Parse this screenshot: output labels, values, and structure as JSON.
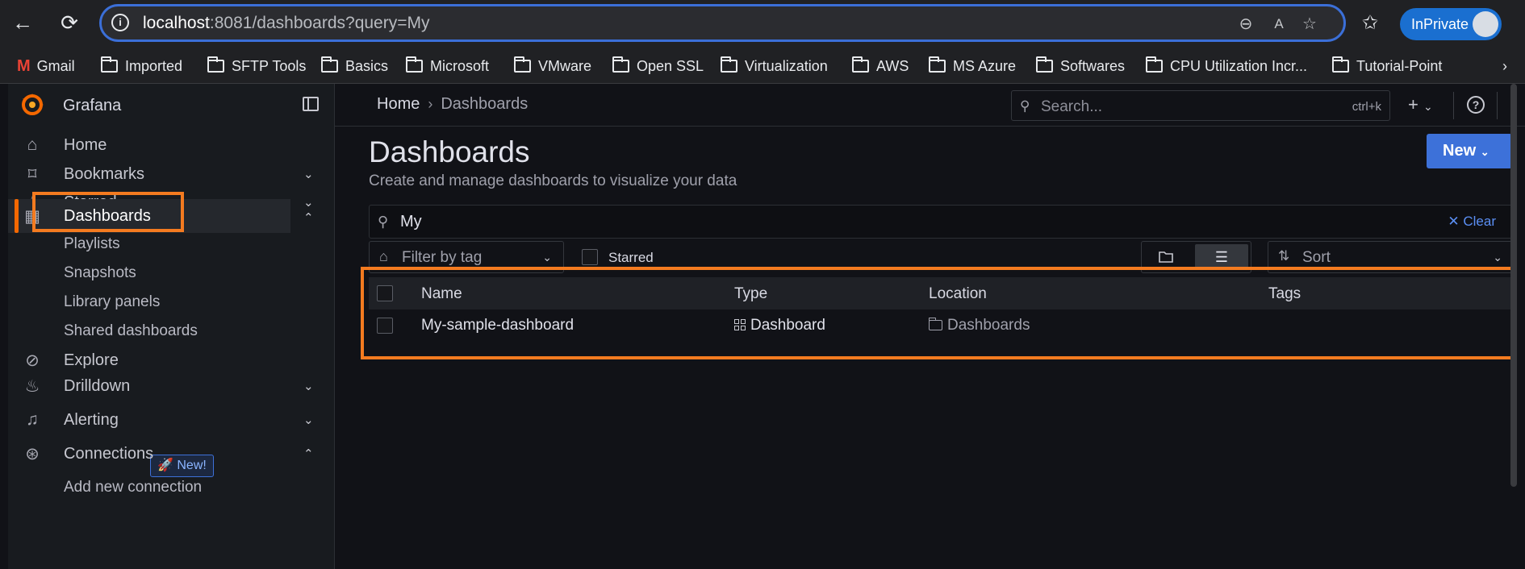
{
  "browser": {
    "url_host": "localhost",
    "url_rest": ":8081/dashboards?query=My",
    "inprivate_label": "InPrivate",
    "bookmarks": [
      "Gmail",
      "Imported",
      "SFTP Tools",
      "Basics",
      "Microsoft",
      "VMware",
      "Open SSL",
      "Virtualization",
      "AWS",
      "MS Azure",
      "Softwares",
      "CPU Utilization Incr...",
      "Tutorial-Point"
    ]
  },
  "sidebar": {
    "brand": "Grafana",
    "items": [
      {
        "label": "Home",
        "icon": "home-icon"
      },
      {
        "label": "Bookmarks",
        "icon": "bookmark-icon"
      },
      {
        "label": "Starred",
        "icon": "star-icon"
      },
      {
        "label": "Dashboards",
        "icon": "dashboards-grid-icon"
      },
      {
        "label": "Explore",
        "icon": "compass-icon"
      },
      {
        "label": "Drilldown",
        "icon": "drilldown-icon"
      },
      {
        "label": "Alerting",
        "icon": "bell-icon"
      },
      {
        "label": "Connections",
        "icon": "connections-icon"
      }
    ],
    "sub_items": [
      "Playlists",
      "Snapshots",
      "Library panels",
      "Shared dashboards"
    ],
    "new_badge": "New!",
    "cutoff_item": "Add new connection"
  },
  "header": {
    "breadcrumb_home": "Home",
    "breadcrumb_current": "Dashboards",
    "search_placeholder": "Search...",
    "search_shortcut": "ctrl+k"
  },
  "main": {
    "title": "Dashboards",
    "subtitle": "Create and manage dashboards to visualize your data",
    "new_button": "New",
    "search_value": "My",
    "clear_label": "Clear",
    "filter_tag_placeholder": "Filter by tag",
    "starred_label": "Starred",
    "sort_label": "Sort",
    "columns": [
      "Name",
      "Type",
      "Location",
      "Tags"
    ],
    "rows": [
      {
        "name": "My-sample-dashboard",
        "type": "Dashboard",
        "location": "Dashboards",
        "tags": ""
      }
    ]
  },
  "colors": {
    "accent": "#f46800",
    "primary": "#3d71d9",
    "highlight": "#f47b20",
    "background": "#111217"
  }
}
